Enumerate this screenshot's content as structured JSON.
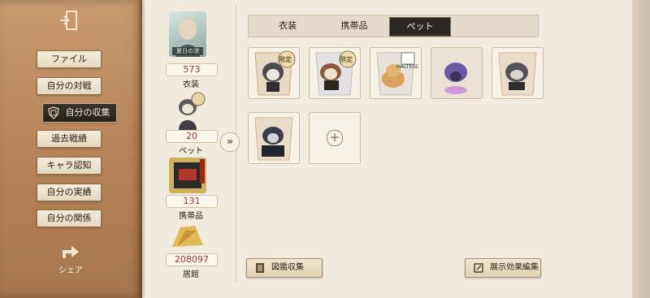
{
  "sidebar": {
    "items": [
      {
        "label": "ファイル"
      },
      {
        "label": "自分の対戦"
      },
      {
        "label": "自分の収集"
      },
      {
        "label": "過去戦績"
      },
      {
        "label": "キャラ認知"
      },
      {
        "label": "自分の実績"
      },
      {
        "label": "自分の関係"
      }
    ],
    "active_index": 2,
    "share_label": "シェア"
  },
  "stats": [
    {
      "value": "573",
      "label": "衣装"
    },
    {
      "value": "20",
      "label": "ペット"
    },
    {
      "value": "131",
      "label": "携帯品"
    },
    {
      "value": "208097",
      "label": "居館"
    }
  ],
  "portrait_tag": "夏日の涼",
  "tabs": [
    {
      "label": "衣装"
    },
    {
      "label": "携帯品"
    },
    {
      "label": "ペット"
    }
  ],
  "active_tab": "ペット",
  "pets": [
    {
      "name": "pet-1",
      "badge": "限定"
    },
    {
      "name": "pet-2",
      "badge": "限定"
    },
    {
      "name": "pet-3",
      "badge": "",
      "tag": "MALTESE"
    },
    {
      "name": "pet-4",
      "badge": ""
    },
    {
      "name": "pet-5",
      "badge": ""
    },
    {
      "name": "pet-6",
      "badge": ""
    }
  ],
  "buttons": {
    "illustrated": "図鑑収集",
    "display_edit": "展示効果編集"
  }
}
